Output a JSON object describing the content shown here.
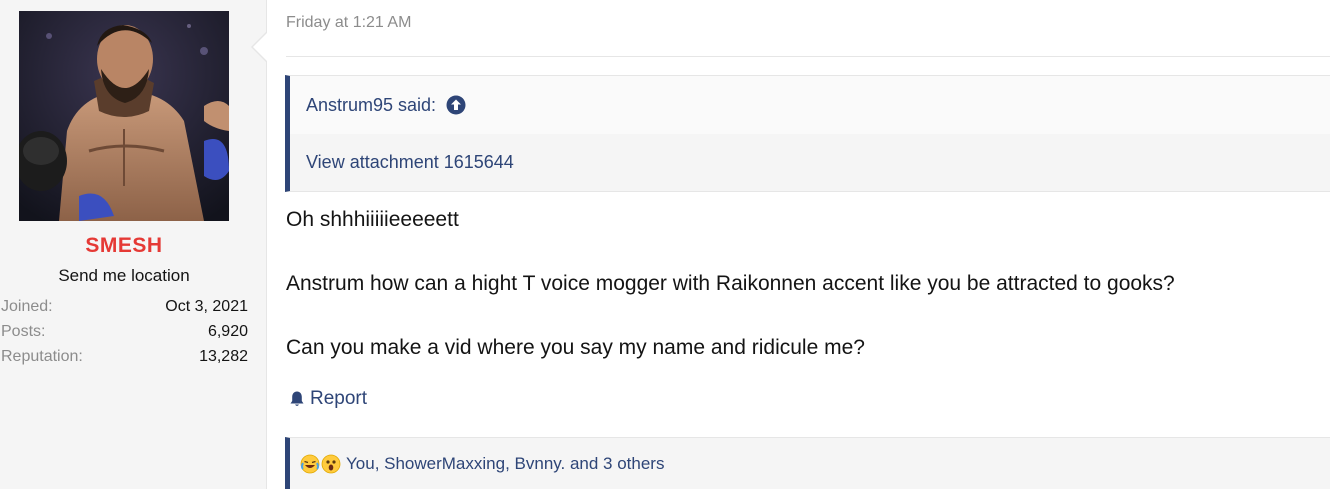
{
  "user": {
    "name": "SMESH",
    "title": "Send me location",
    "stats": [
      {
        "label": "Joined:",
        "value": "Oct 3, 2021"
      },
      {
        "label": "Posts:",
        "value": "6,920"
      },
      {
        "label": "Reputation:",
        "value": "13,282"
      }
    ],
    "name_color": "#e53935"
  },
  "post": {
    "date": "Friday at 1:21 AM",
    "quote": {
      "author": "Anstrum95 said:",
      "icon": "arrow-circle-up-icon",
      "body": "View attachment 1615644"
    },
    "message": [
      "Oh shhhiiiiieeeeett",
      "Anstrum how can a hight T voice mogger with Raikonnen accent like you be attracted to gooks?",
      "Can you make a vid where you say my name and ridicule me?"
    ],
    "report_label": "Report",
    "report_icon": "bell-icon",
    "reactions": {
      "icons": [
        "crying-laughing-emoji-icon",
        "shocked-emoji-icon"
      ],
      "text": "You, ShowerMaxxing, Bvnny. and 3 others"
    }
  },
  "colors": {
    "link": "#2e4577",
    "muted": "#8c8c8c",
    "sidebar_bg": "#f5f5f5"
  }
}
